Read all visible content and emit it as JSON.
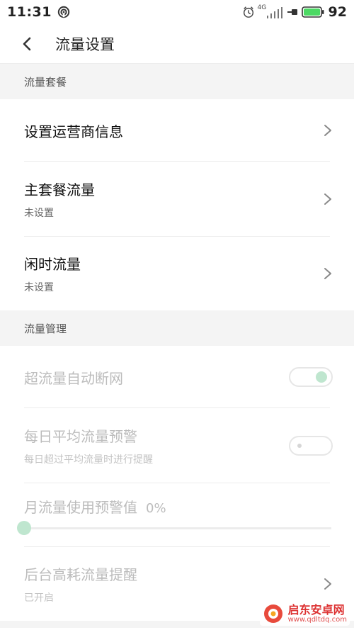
{
  "status_bar": {
    "time": "11:31",
    "network_label": "4G",
    "battery_percent": "92",
    "icons": [
      "hotspot-icon",
      "alarm-clock-icon",
      "signal-icon",
      "charging-icon",
      "battery-icon"
    ]
  },
  "header": {
    "title": "流量设置",
    "back_icon": "chevron-left-icon"
  },
  "sections": [
    {
      "title": "流量套餐",
      "items": [
        {
          "label": "设置运营商信息",
          "sublabel": ""
        },
        {
          "label": "主套餐流量",
          "sublabel": "未设置"
        },
        {
          "label": "闲时流量",
          "sublabel": "未设置"
        }
      ]
    },
    {
      "title": "流量管理",
      "items": [
        {
          "label": "超流量自动断网",
          "control": "toggle",
          "state": "on"
        },
        {
          "label": "每日平均流量预警",
          "sublabel": "每日超过平均流量时进行提醒",
          "control": "toggle",
          "state": "off"
        },
        {
          "label": "月流量使用预警值",
          "value": "0%",
          "level_percent": 0
        },
        {
          "label": "后台高耗流量提醒",
          "sublabel": "已开启"
        }
      ]
    }
  ],
  "watermark": {
    "title": "启东安卓网",
    "url": "www.qdltdq.com"
  },
  "colors": {
    "accent_disabled": "#bfe6cf",
    "section_bg": "#f4f4f4",
    "divider": "#ececec"
  }
}
